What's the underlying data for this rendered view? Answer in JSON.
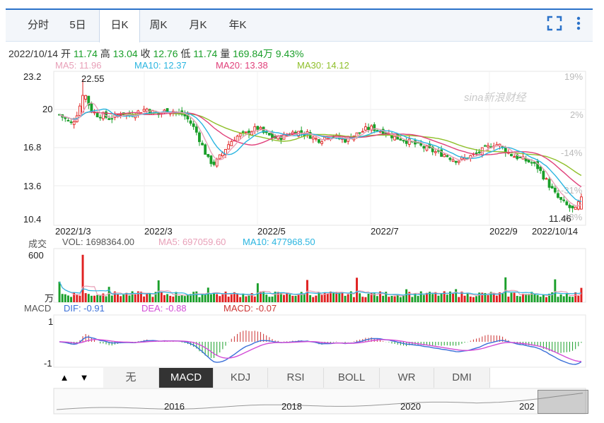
{
  "tabs": [
    {
      "label": "分时",
      "active": false
    },
    {
      "label": "5日",
      "active": false
    },
    {
      "label": "日K",
      "active": true
    },
    {
      "label": "周K",
      "active": false
    },
    {
      "label": "月K",
      "active": false
    },
    {
      "label": "年K",
      "active": false
    }
  ],
  "info": {
    "date": "2022/10/14",
    "open_label": "开",
    "open": "11.74",
    "high_label": "高",
    "high": "13.04",
    "close_label": "收",
    "close": "12.76",
    "low_label": "低",
    "low": "11.74",
    "vol_label": "量",
    "vol": "169.84万",
    "pct": "9.43%"
  },
  "ma": {
    "ma5": "MA5: 11.96",
    "ma10": "MA10: 12.37",
    "ma20": "MA20: 13.38",
    "ma30": "MA30: 14.12"
  },
  "colors": {
    "up": "#e02020",
    "down": "#1a9f2a",
    "ma5": "#e8a0b8",
    "ma10": "#2ab5e0",
    "ma20": "#e0407a",
    "ma30": "#8fbf2a",
    "dif": "#3a6fd8",
    "dea": "#d24bd6",
    "macd": "#cc3333",
    "accent": "#2b72c9"
  },
  "watermark": "sina新浪财经",
  "main_chart": {
    "yticks": [
      "23.2",
      "20",
      "16.8",
      "13.6",
      "10.4"
    ],
    "pct_ticks": [
      "19%",
      "2%",
      "-14%",
      "-31%",
      "-48%"
    ],
    "xlabels": [
      "2022/1/3",
      "2022/3",
      "2022/5",
      "2022/7",
      "2022/9",
      "2022/10/14"
    ],
    "max_label": "22.55",
    "min_label": "11.46"
  },
  "volume": {
    "label": "成交",
    "vol_text": "VOL: 1698364.00",
    "ma5_text": "MA5: 697059.60",
    "ma10_text": "MA10: 477968.50",
    "ytop": "600",
    "unit": "万"
  },
  "macd": {
    "label": "MACD",
    "dif_text": "DIF: -0.91",
    "dea_text": "DEA: -0.88",
    "macd_text": "MACD: -0.07",
    "ytop": "1",
    "ybot": "-1"
  },
  "bottom_tabs": [
    "无",
    "MACD",
    "KDJ",
    "RSI",
    "BOLL",
    "WR",
    "DMI"
  ],
  "bottom_active": "MACD",
  "nav": {
    "up_arrow": "▲",
    "down_arrow": "▼",
    "years": [
      "2016",
      "2018",
      "2020",
      "202"
    ]
  },
  "chart_data": {
    "type": "candlestick",
    "x_range": [
      "2022/1/3",
      "2022/10/14"
    ],
    "ylim": [
      10.4,
      23.2
    ],
    "close_series": [
      19.6,
      19.2,
      18.8,
      19.9,
      21.5,
      20.0,
      19.6,
      19.5,
      19.3,
      19.4,
      19.8,
      19.5,
      19.7,
      19.9,
      20.1,
      19.8,
      19.6,
      19.9,
      20.0,
      19.7,
      19.6,
      19.0,
      18.2,
      17.0,
      15.8,
      15.5,
      16.2,
      17.0,
      17.6,
      17.9,
      18.0,
      18.3,
      18.5,
      18.0,
      17.8,
      17.6,
      17.8,
      18.0,
      18.2,
      18.1,
      18.0,
      17.6,
      17.5,
      17.8,
      17.9,
      17.6,
      17.5,
      17.8,
      18.0,
      18.3,
      18.5,
      18.4,
      18.2,
      18.0,
      17.7,
      17.6,
      17.4,
      17.2,
      17.0,
      16.8,
      16.6,
      16.4,
      16.3,
      16.0,
      15.8,
      15.9,
      16.1,
      16.3,
      16.6,
      16.9,
      17.2,
      17.0,
      16.5,
      16.2,
      16.0,
      15.8,
      15.6,
      15.2,
      14.4,
      13.6,
      12.8,
      12.3,
      11.9,
      11.6,
      12.76
    ],
    "high_max": 22.55,
    "low_min": 11.46,
    "last": {
      "open": 11.74,
      "high": 13.04,
      "close": 12.76,
      "low": 11.74,
      "volume_wan": 169.84,
      "pct": 9.43
    },
    "ma": {
      "ma5": 11.96,
      "ma10": 12.37,
      "ma20": 13.38,
      "ma30": 14.12
    },
    "volume_ylim_wan": [
      0,
      600
    ],
    "macd_ylim": [
      -1,
      1
    ],
    "macd_last": {
      "dif": -0.91,
      "dea": -0.88,
      "macd": -0.07
    }
  }
}
